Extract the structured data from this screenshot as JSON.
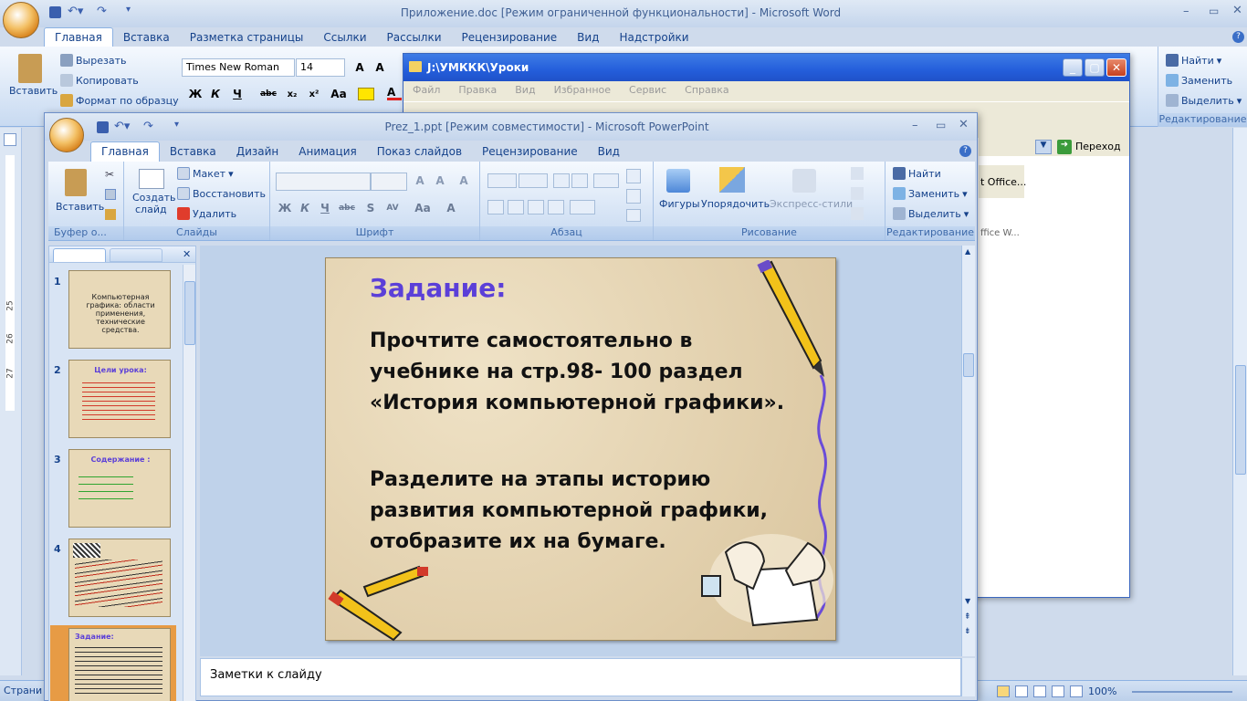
{
  "word": {
    "title": "Приложение.doc [Режим ограниченной функциональности] - Microsoft Word",
    "tabs": [
      "Главная",
      "Вставка",
      "Разметка страницы",
      "Ссылки",
      "Рассылки",
      "Рецензирование",
      "Вид",
      "Надстройки"
    ],
    "clipboard": {
      "paste": "Вставить",
      "cut": "Вырезать",
      "copy": "Копировать",
      "format": "Формат по образцу"
    },
    "font_name": "Times New Roman",
    "font_size": "14",
    "edit": {
      "find": "Найти",
      "replace": "Заменить",
      "select": "Выделить",
      "label": "Редактирование"
    },
    "status_left": "Страни",
    "zoom": "100%",
    "ruler_marks": [
      "25",
      "26",
      "27"
    ]
  },
  "explorer": {
    "title": "J:\\УМККК\\Уроки",
    "menu": [
      "Файл",
      "Правка",
      "Вид",
      "Избранное",
      "Сервис",
      "Справка"
    ],
    "go_label": "Переход",
    "item1": "t Office...",
    "item2": "ffice W..."
  },
  "ppt": {
    "title": "Prez_1.ppt [Режим совместимости] - Microsoft PowerPoint",
    "tabs": [
      "Главная",
      "Вставка",
      "Дизайн",
      "Анимация",
      "Показ слайдов",
      "Рецензирование",
      "Вид"
    ],
    "groups": {
      "clipboard": {
        "paste": "Вставить",
        "label": "Буфер о..."
      },
      "slides": {
        "create": "Создать",
        "slide": "слайд",
        "layout": "Макет",
        "restore": "Восстановить",
        "delete": "Удалить",
        "label": "Слайды"
      },
      "font": {
        "label": "Шрифт"
      },
      "paragraph": {
        "label": "Абзац"
      },
      "drawing": {
        "shapes": "Фигуры",
        "arrange": "Упорядочить",
        "styles": "Экспресс-стили",
        "label": "Рисование"
      },
      "editing": {
        "find": "Найти",
        "replace": "Заменить",
        "select": "Выделить",
        "label": "Редактирование"
      }
    },
    "slide_numbers": [
      "1",
      "2",
      "3",
      "4",
      "5"
    ],
    "thumbs": [
      {
        "text": "Компьютерная графика: области применения, технические средства."
      },
      {
        "title": "Цели урока:"
      },
      {
        "title": "Содержание :"
      },
      {
        "title": ""
      },
      {
        "title": "Задание:"
      }
    ],
    "slide": {
      "title": "Задание:",
      "para1": "Прочтите самостоятельно в учебнике на стр.98- 100 раздел «История компьютерной графики».",
      "para2": "Разделите на этапы историю развития компьютерной графики, отобразите их на бумаге."
    },
    "notes_placeholder": "Заметки к слайду"
  },
  "colors": {
    "accent": "#15428b",
    "slide_title": "#5b3fd8",
    "ribbon": "#d5e3f5"
  }
}
